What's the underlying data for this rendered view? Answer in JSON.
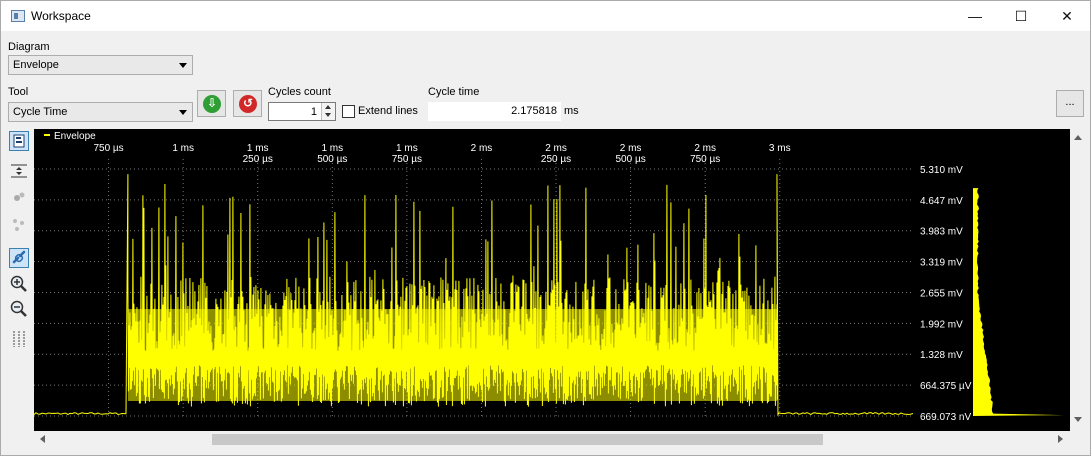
{
  "window": {
    "title": "Workspace"
  },
  "titlebar": {
    "min_label": "—",
    "max_label": "☐",
    "close_label": "✕"
  },
  "diagram": {
    "label": "Diagram",
    "selected": "Envelope"
  },
  "tool": {
    "label": "Tool",
    "selected": "Cycle Time"
  },
  "buttons": {
    "start_icon": "green-down-arrow-icon",
    "stop_icon": "red-undo-icon",
    "more_label": "..."
  },
  "cycles": {
    "label": "Cycles count",
    "value": "1"
  },
  "extend_lines": {
    "label": "Extend lines",
    "checked": false
  },
  "cycle_time": {
    "label": "Cycle time",
    "value": "2.175818",
    "unit": "ms"
  },
  "side_tools": [
    "cursor-tool-icon",
    "fit-vertical-icon",
    "droplets-icon",
    "scatter-icon",
    "link-icon",
    "zoom-in-icon",
    "zoom-out-icon",
    "markers-icon"
  ],
  "chart_data": {
    "type": "area",
    "legend": "Envelope",
    "legend_color": "#ffff00",
    "x_ticks": [
      {
        "t": 0.75,
        "l1": "750 µs",
        "l2": ""
      },
      {
        "t": 1.0,
        "l1": "1 ms",
        "l2": ""
      },
      {
        "t": 1.25,
        "l1": "1 ms",
        "l2": "250 µs"
      },
      {
        "t": 1.5,
        "l1": "1 ms",
        "l2": "500 µs"
      },
      {
        "t": 1.75,
        "l1": "1 ms",
        "l2": "750 µs"
      },
      {
        "t": 2.0,
        "l1": "2 ms",
        "l2": ""
      },
      {
        "t": 2.25,
        "l1": "2 ms",
        "l2": "250 µs"
      },
      {
        "t": 2.5,
        "l1": "2 ms",
        "l2": "500 µs"
      },
      {
        "t": 2.75,
        "l1": "2 ms",
        "l2": "750 µs"
      },
      {
        "t": 3.0,
        "l1": "3 ms",
        "l2": ""
      }
    ],
    "y_ticks": [
      {
        "v": 0.000669073,
        "l": "669.073 nV"
      },
      {
        "v": 0.664375,
        "l": "664.375 µV"
      },
      {
        "v": 1.328,
        "l": "1.328 mV"
      },
      {
        "v": 1.992,
        "l": "1.992 mV"
      },
      {
        "v": 2.655,
        "l": "2.655 mV"
      },
      {
        "v": 3.319,
        "l": "3.319 mV"
      },
      {
        "v": 3.983,
        "l": "3.983 mV"
      },
      {
        "v": 4.647,
        "l": "4.647 mV"
      },
      {
        "v": 5.31,
        "l": "5.310 mV"
      }
    ],
    "x_range_ms": [
      0.5,
      3.45
    ],
    "y_range_mV": [
      0,
      5.31
    ],
    "cycle_start_ms": 0.8148,
    "cycle_end_ms": 2.9906,
    "baseline_mV": 0.03,
    "grid": true
  }
}
